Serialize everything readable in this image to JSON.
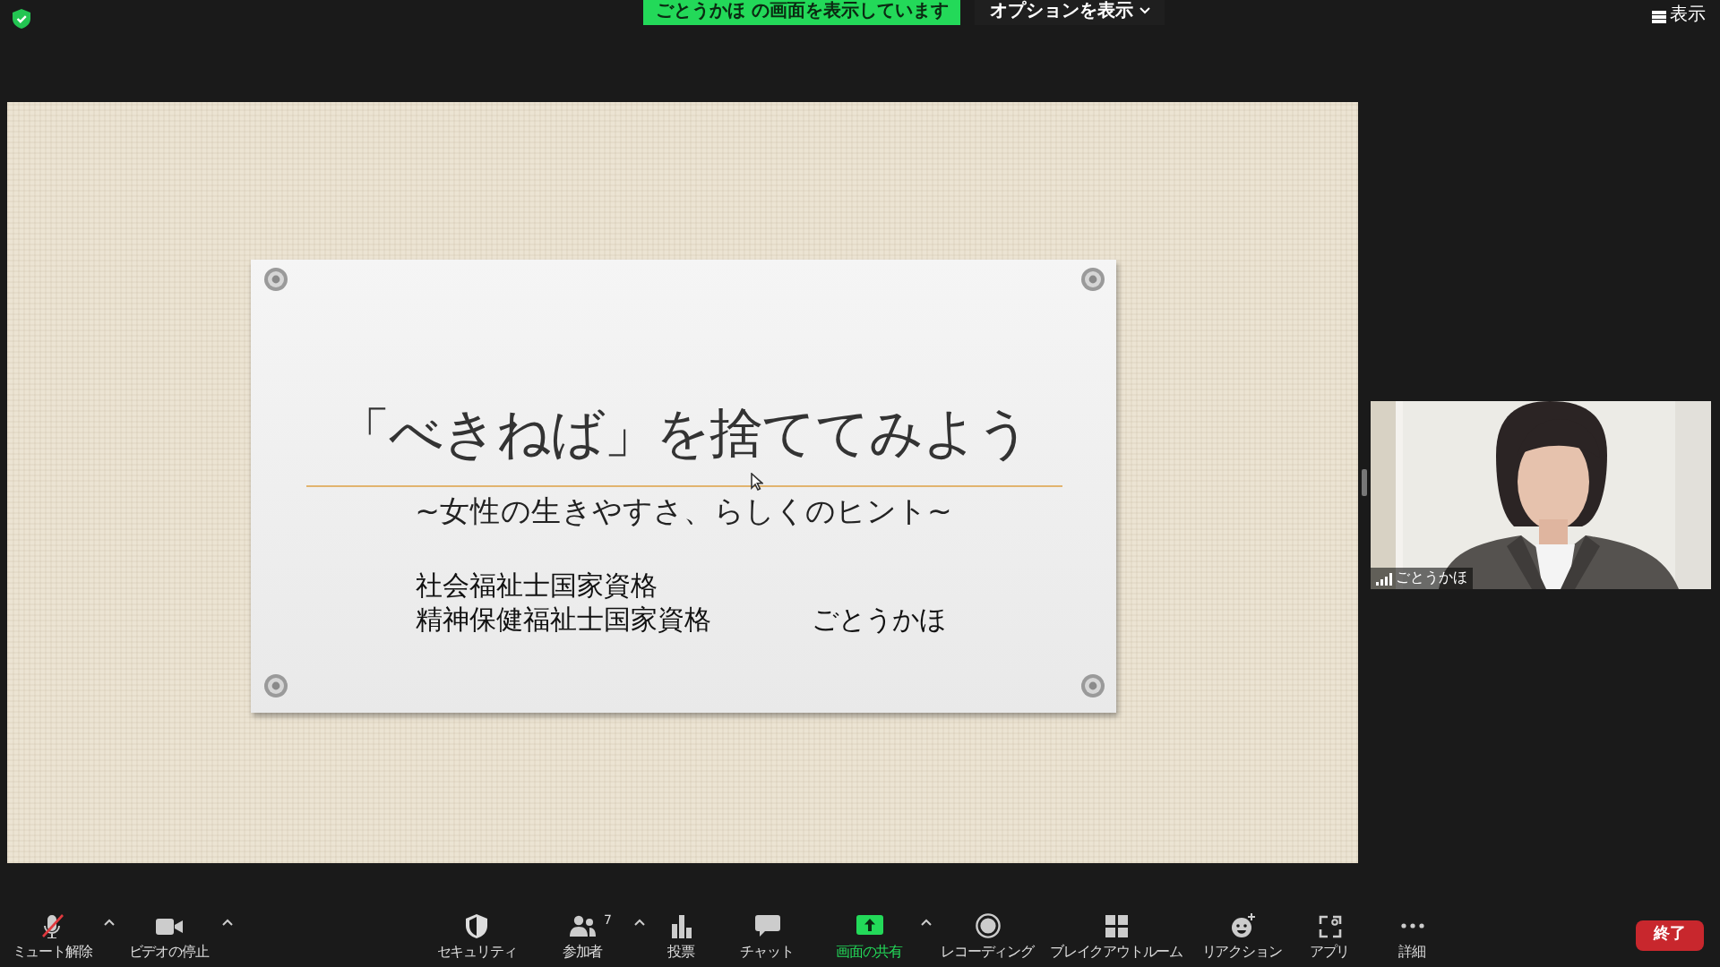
{
  "top_bar": {
    "share_banner": "ごとうかほ の画面を表示しています",
    "options_button": "オプションを表示",
    "view_button": "表示"
  },
  "slide": {
    "title": "「べきねば」を捨ててみよう",
    "subtitle": "~女性の生きやすさ、らしくのヒント~",
    "credentials": [
      "社会福祉士国家資格",
      "精神保健福祉士国家資格"
    ],
    "author": "ごとうかほ"
  },
  "video_tile": {
    "name": "ごとうかほ"
  },
  "toolbar": {
    "left": [
      {
        "label": "ミュート解除",
        "has_menu": true,
        "off": true,
        "active": false
      },
      {
        "label": "ビデオの停止",
        "has_menu": true,
        "off": false,
        "active": false
      }
    ],
    "center": [
      {
        "label": "セキュリティ",
        "has_menu": false,
        "off": false,
        "active": false
      },
      {
        "label": "参加者",
        "has_menu": true,
        "off": false,
        "active": false,
        "count": "7"
      },
      {
        "label": "投票",
        "has_menu": false,
        "off": false,
        "active": false
      },
      {
        "label": "チャット",
        "has_menu": false,
        "off": false,
        "active": false
      },
      {
        "label": "画面の共有",
        "has_menu": true,
        "off": false,
        "active": true
      },
      {
        "label": "レコーディング",
        "has_menu": false,
        "off": false,
        "active": false
      },
      {
        "label": "ブレイクアウトルーム",
        "has_menu": false,
        "off": false,
        "active": false
      },
      {
        "label": "リアクション",
        "has_menu": false,
        "off": false,
        "active": false
      },
      {
        "label": "アプリ",
        "has_menu": false,
        "off": false,
        "active": false
      },
      {
        "label": "詳細",
        "has_menu": false,
        "off": false,
        "active": false
      }
    ],
    "end_button": "終了"
  }
}
